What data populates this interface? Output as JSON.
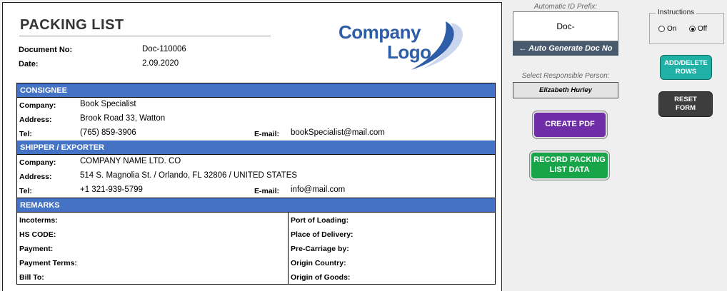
{
  "document": {
    "title": "PACKING LIST",
    "doc_no_label": "Document No:",
    "doc_no": "Doc-110006",
    "date_label": "Date:",
    "date": "2.09.2020"
  },
  "logo": {
    "line1": "Company",
    "line2": "Logo",
    "color": "#2e5da8"
  },
  "consignee": {
    "heading": "CONSIGNEE",
    "company_label": "Company:",
    "company": "Book Specialist",
    "address_label": "Address:",
    "address": "Brook Road 33, Watton",
    "tel_label": "Tel:",
    "tel": "(765) 859-3906",
    "email_label": "E-mail:",
    "email": "bookSpecialist@mail.com"
  },
  "shipper": {
    "heading": "SHIPPER / EXPORTER",
    "company_label": "Company:",
    "company": "COMPANY NAME LTD. CO",
    "address_label": "Address:",
    "address": "514 S. Magnolia St. / Orlando, FL 32806 / UNITED STATES",
    "tel_label": "Tel:",
    "tel": "+1 321-939-5799",
    "email_label": "E-mail:",
    "email": "info@mail.com"
  },
  "remarks": {
    "heading": "REMARKS",
    "left": [
      "Incoterms:",
      "HS CODE:",
      "Payment:",
      "Payment Terms:",
      "Bill To:"
    ],
    "right": [
      "Port of Loading:",
      "Place of Delivery:",
      "Pre-Carriage by:",
      "Origin Country:",
      "Origin of Goods:"
    ]
  },
  "panel": {
    "prefix_label": "Automatic ID Prefix:",
    "prefix_value": "Doc-",
    "autogen_label": "←  Auto Generate Doc No",
    "responsible_label": "Select Responsible Person:",
    "responsible_value": "Elizabeth Hurley",
    "create_pdf": "CREATE PDF",
    "record_line1": "RECORD PACKING",
    "record_line2": "LIST DATA",
    "add_rows_line1": "ADD/DELETE",
    "add_rows_line2": "ROWS",
    "reset_line1": "RESET",
    "reset_line2": "FORM"
  },
  "instructions": {
    "title": "Instructions",
    "on_label": "On",
    "off_label": "Off",
    "selected": "Off"
  },
  "colors": {
    "section_header": "#4472c4",
    "create_pdf": "#6f2da8",
    "record": "#18a54a",
    "add_rows": "#1fb0a6",
    "reset": "#3d3d3d",
    "autogen": "#4a5a6e"
  }
}
